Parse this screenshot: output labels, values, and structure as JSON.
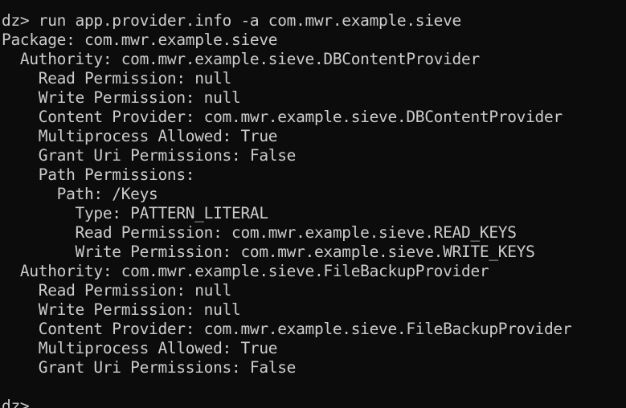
{
  "terminal": {
    "prompt": "dz>",
    "lines": [
      "dz> run app.provider.info -a com.mwr.example.sieve",
      "Package: com.mwr.example.sieve",
      "  Authority: com.mwr.example.sieve.DBContentProvider",
      "    Read Permission: null",
      "    Write Permission: null",
      "    Content Provider: com.mwr.example.sieve.DBContentProvider",
      "    Multiprocess Allowed: True",
      "    Grant Uri Permissions: False",
      "    Path Permissions:",
      "      Path: /Keys",
      "        Type: PATTERN_LITERAL",
      "        Read Permission: com.mwr.example.sieve.READ_KEYS",
      "        Write Permission: com.mwr.example.sieve.WRITE_KEYS",
      "  Authority: com.mwr.example.sieve.FileBackupProvider",
      "    Read Permission: null",
      "    Write Permission: null",
      "    Content Provider: com.mwr.example.sieve.FileBackupProvider",
      "    Multiprocess Allowed: True",
      "    Grant Uri Permissions: False",
      "",
      "dz>"
    ]
  },
  "colors": {
    "background": "#0c0c0c",
    "text": "#cccccc"
  }
}
